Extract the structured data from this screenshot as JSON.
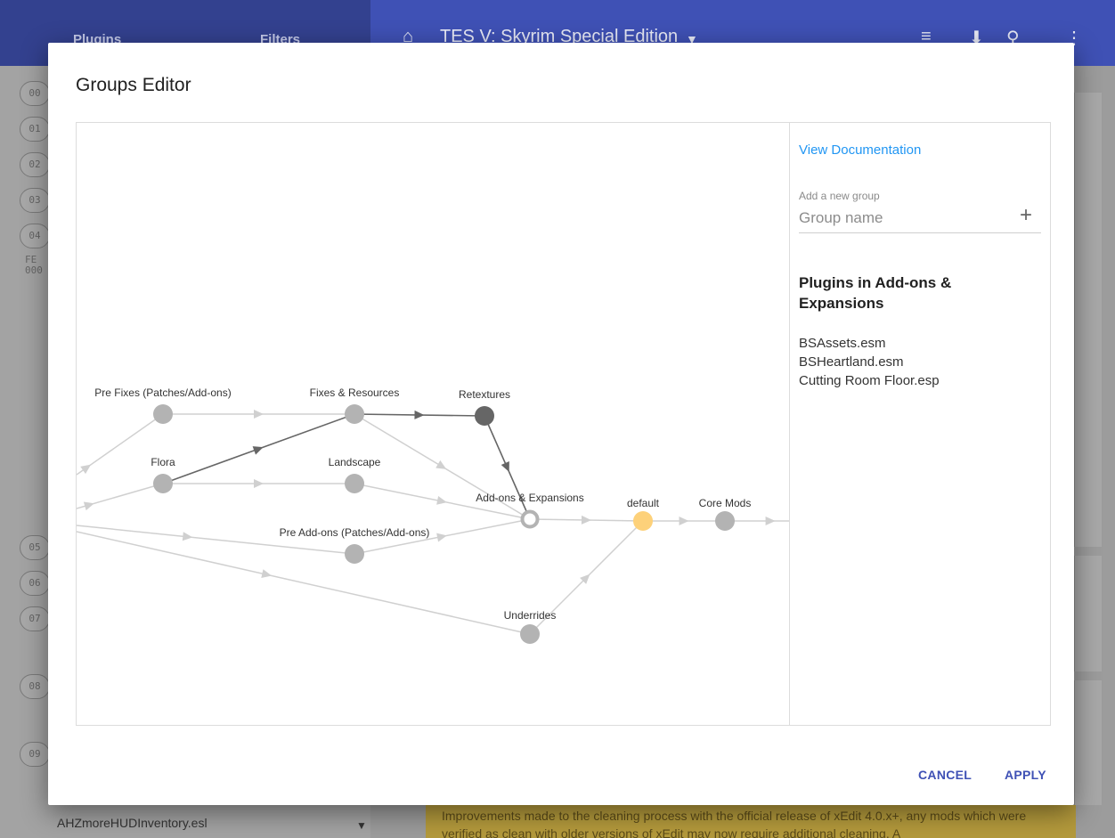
{
  "app": {
    "tabs": [
      "Plugins",
      "Filters"
    ],
    "game_title": "TES V: Skyrim Special Edition",
    "indices_top": [
      "00",
      "01",
      "02",
      "03",
      "04"
    ],
    "fe_label": [
      "FE",
      "000"
    ],
    "indices_bottom": [
      "05",
      "06",
      "07",
      "08",
      "09"
    ],
    "bottom_plugin": "AHZmoreHUDInventory.esl",
    "banner_text": "Improvements made to the cleaning process with the official release of xEdit 4.0.x+, any mods which were verified as clean with older versions of xEdit may now require additional cleaning. A"
  },
  "dialog": {
    "title": "Groups Editor",
    "doc_link": "View Documentation",
    "add_group_label": "Add a new group",
    "group_name_placeholder": "Group name",
    "group_name_value": "",
    "plugins_title": "Plugins in Add-ons & Expansions",
    "plugins": [
      "BSAssets.esm",
      "BSHeartland.esm",
      "Cutting Room Floor.esp"
    ],
    "cancel_label": "CANCEL",
    "apply_label": "APPLY"
  },
  "graph": {
    "nodes": [
      {
        "id": "prefixes",
        "label": "Pre Fixes (Patches/Add-ons)",
        "state": "normal"
      },
      {
        "id": "fixes",
        "label": "Fixes & Resources",
        "state": "normal"
      },
      {
        "id": "retextures",
        "label": "Retextures",
        "state": "highlighted"
      },
      {
        "id": "flora",
        "label": "Flora",
        "state": "normal"
      },
      {
        "id": "landscape",
        "label": "Landscape",
        "state": "normal"
      },
      {
        "id": "addons",
        "label": "Add-ons & Expansions",
        "state": "selected"
      },
      {
        "id": "default",
        "label": "default",
        "state": "default"
      },
      {
        "id": "coremods",
        "label": "Core Mods",
        "state": "normal"
      },
      {
        "id": "preaddons",
        "label": "Pre Add-ons (Patches/Add-ons)",
        "state": "normal"
      },
      {
        "id": "underrides",
        "label": "Underrides",
        "state": "normal"
      }
    ],
    "edges": [
      {
        "from": "prefixes",
        "to": "fixes",
        "highlight": false
      },
      {
        "from": "fixes",
        "to": "retextures",
        "highlight": true
      },
      {
        "from": "retextures",
        "to": "addons",
        "highlight": true
      },
      {
        "from": "flora",
        "to": "fixes",
        "highlight": true
      },
      {
        "from": "flora",
        "to": "landscape",
        "highlight": false
      },
      {
        "from": "fixes",
        "to": "addons",
        "highlight": false
      },
      {
        "from": "landscape",
        "to": "addons",
        "highlight": false
      },
      {
        "from": "preaddons",
        "to": "addons",
        "highlight": false
      },
      {
        "from": "addons",
        "to": "default",
        "highlight": false
      },
      {
        "from": "default",
        "to": "coremods",
        "highlight": false
      },
      {
        "from": "underrides",
        "to": "default",
        "highlight": false
      }
    ],
    "colors": {
      "node": "#b3b3b3",
      "highlighted": "#666666",
      "default": "#fdd17a",
      "edge": "#d0d0d0",
      "edge_highlight": "#666666"
    }
  }
}
